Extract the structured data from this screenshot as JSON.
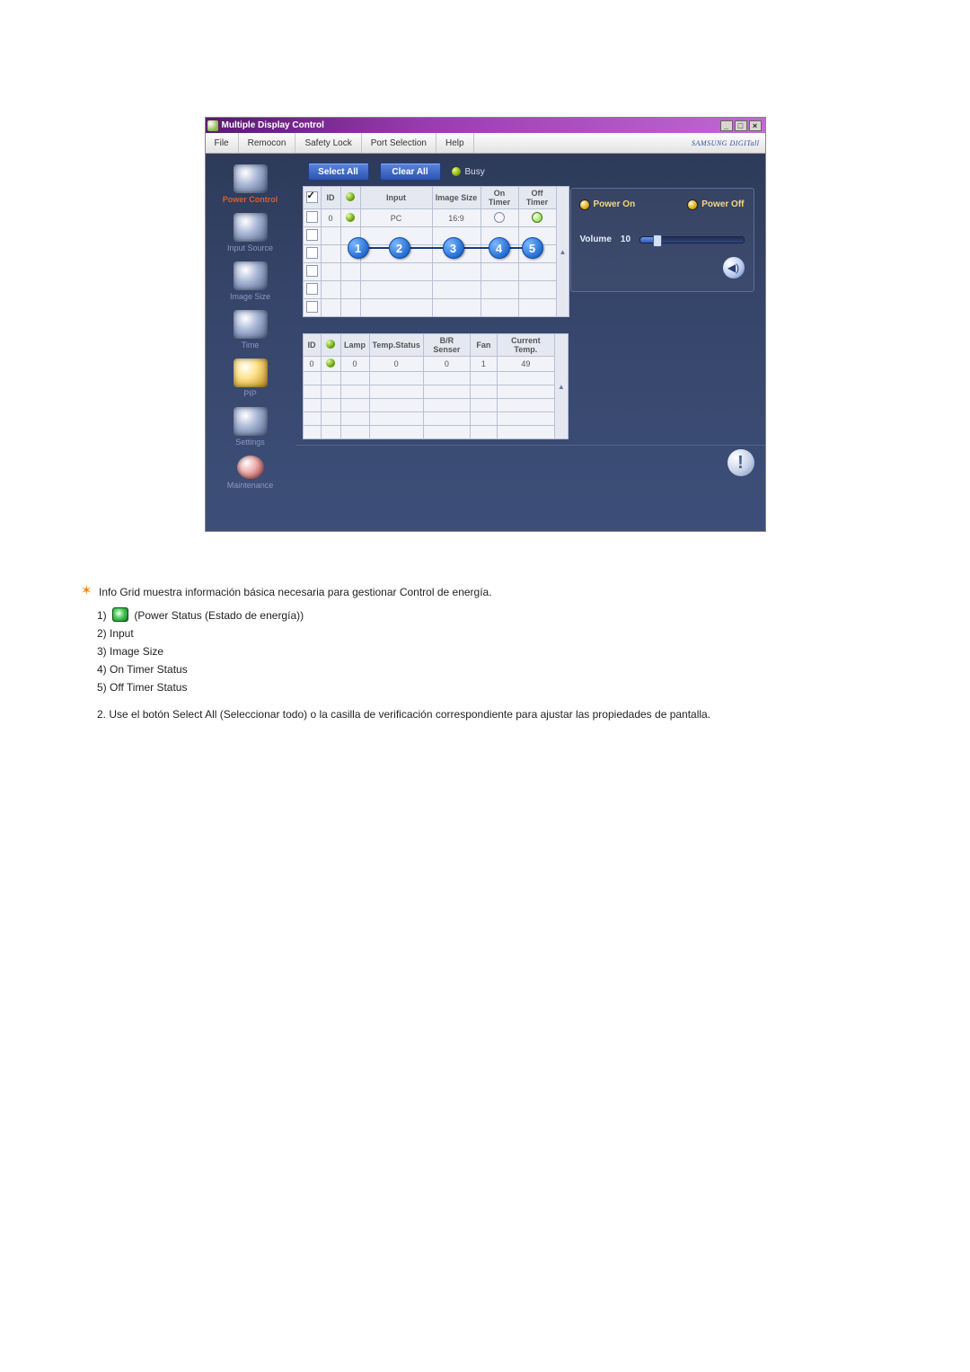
{
  "window": {
    "title": "Multiple Display Control"
  },
  "menu": {
    "file": "File",
    "remocon": "Remocon",
    "safety": "Safety Lock",
    "port": "Port Selection",
    "help": "Help",
    "brand": "SAMSUNG DIGITall"
  },
  "sidebar": {
    "power": "Power Control",
    "input": "Input Source",
    "image": "Image Size",
    "time": "Time",
    "pip": "PIP",
    "settings": "Settings",
    "maintenance": "Maintenance"
  },
  "buttons": {
    "select_all": "Select All",
    "clear_all": "Clear All",
    "busy": "Busy"
  },
  "grid1": {
    "headers": {
      "id": "ID",
      "input": "Input",
      "imagesize": "Image Size",
      "ontimer": "On Timer",
      "offtimer": "Off Timer"
    },
    "row0": {
      "id": "0",
      "input": "PC",
      "imagesize": "16:9"
    }
  },
  "grid2": {
    "headers": {
      "id": "ID",
      "lamp": "Lamp",
      "temp": "Temp.Status",
      "br": "B/R Senser",
      "fan": "Fan",
      "cur": "Current Temp."
    },
    "row0": {
      "id": "0",
      "lamp": "0",
      "temp": "0",
      "br": "0",
      "fan": "1",
      "cur": "49"
    }
  },
  "panel": {
    "poweron": "Power On",
    "poweroff": "Power Off",
    "volume": "Volume",
    "volvalue": "10"
  },
  "badges": {
    "b1": "1",
    "b2": "2",
    "b3": "3",
    "b4": "4",
    "b5": "5"
  },
  "doc": {
    "intro": "Info Grid muestra información básica necesaria para gestionar Control de energía.",
    "l1_prefix": "1) ",
    "l1_suffix": " (Power Status (Estado de energía))",
    "l2": "2) Input",
    "l3": "3) Image Size",
    "l4": "4) On Timer Status",
    "l5": "5) Off Timer Status",
    "p2_a": "2.  Use el botón Select All (Seleccionar todo) o la casilla de verificación correspondiente para ajustar las propiedades de pantalla.",
    "p2_b": ""
  }
}
